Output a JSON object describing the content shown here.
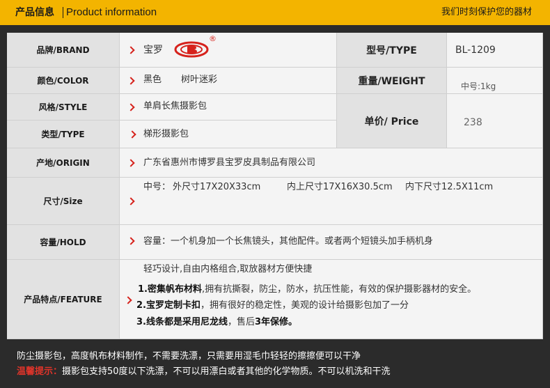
{
  "header": {
    "title": "产品信息",
    "subtitle": "Product information",
    "slogan": "我们时刻保护您的器材"
  },
  "rows": {
    "brand": {
      "label": "品牌/BRAND",
      "value": "宝罗",
      "reg": "®"
    },
    "color": {
      "label": "颜色/COLOR",
      "values": [
        "黑色",
        "树叶迷彩"
      ]
    },
    "style": {
      "label": "风格/STYLE",
      "value": "单肩长焦摄影包"
    },
    "type": {
      "label": "类型/TYPE",
      "value": "梯形摄影包"
    },
    "origin": {
      "label": "产地/ORIGIN",
      "value": "广东省惠州市博罗县宝罗皮具制品有限公司"
    },
    "size": {
      "label": "尺寸/Size",
      "prefix": "中号：",
      "outer": "外尺寸17X20X33cm",
      "inner_top": "内上尺寸17X16X30.5cm",
      "inner_bottom": "内下尺寸12.5X11cm"
    },
    "hold": {
      "label": "容量/HOLD",
      "value": "容量：一个机身加一个长焦镜头，其他配件。或者两个短镜头加手柄机身"
    },
    "feature": {
      "label": "产品特点/FEATURE",
      "intro": "轻巧设计,自由内格组合,取放器材方便快捷",
      "f1_bold": "1.密集帆布材料",
      "f1_rest": ",拥有抗撕裂，防尘，防水，抗压性能，有效的保护摄影器材的安全。",
      "f2_bold": "2.宝罗定制卡扣",
      "f2_rest": "，拥有很好的稳定性，美观的设计给摄影包加了一分",
      "f3_bold": "3.线条都是采用尼龙线",
      "f3_mid": "，售后",
      "f3_red": "3年保修。"
    }
  },
  "specs": {
    "model": {
      "label": "型号/TYPE",
      "value": "BL-1209"
    },
    "weight": {
      "label": "重量/WEIGHT",
      "value": "中号:1kg"
    },
    "price": {
      "label": "单价/ Price",
      "value": "238"
    }
  },
  "footer": {
    "line1": "防尘摄影包，高度帆布材料制作，不需要洗漂，只需要用湿毛巾轻轻的擦擦便可以干净",
    "warm_label": "温馨提示：",
    "line2": "摄影包支持50度以下洗漂，不可以用漂白或者其他的化学物质。不可以机洗和干洗"
  },
  "colors": {
    "accent": "#f3b400",
    "red": "#d6221c",
    "dark": "#2b2b2b"
  }
}
